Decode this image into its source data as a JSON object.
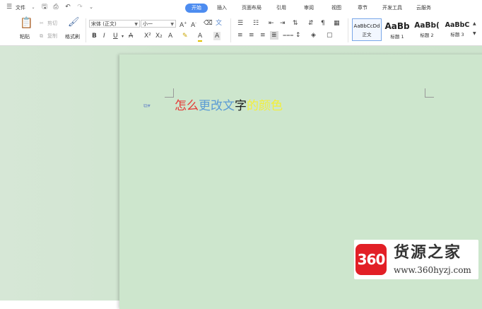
{
  "menubar": {
    "file_menu": "文件",
    "tabs": [
      "开始",
      "插入",
      "页面布局",
      "引用",
      "审阅",
      "视图",
      "章节",
      "开发工具",
      "云服务"
    ],
    "active_tab": "开始"
  },
  "ribbon": {
    "clipboard": {
      "paste": "粘贴",
      "cut": "剪切",
      "copy": "复制",
      "format_painter": "格式刷"
    },
    "font": {
      "name": "宋体 (正文)",
      "size": "小一"
    },
    "styles": [
      {
        "preview": "AaBbCcDd",
        "name": "正文"
      },
      {
        "preview": "AaBb",
        "name": "标题 1"
      },
      {
        "preview": "AaBb(",
        "name": "标题 2"
      },
      {
        "preview": "AaBbC",
        "name": "标题 3"
      }
    ]
  },
  "document": {
    "colored_text": [
      {
        "text": "怎么",
        "color": "#e53935"
      },
      {
        "text": "更改文",
        "color": "#5b9bd5"
      },
      {
        "text": "字",
        "color": "#1a1a1a"
      },
      {
        "text": "的颜色",
        "color": "#f3ef3a"
      }
    ]
  },
  "watermark": {
    "logo_text": "360",
    "title": "货源之家",
    "url": "www.360hyzj.com"
  }
}
